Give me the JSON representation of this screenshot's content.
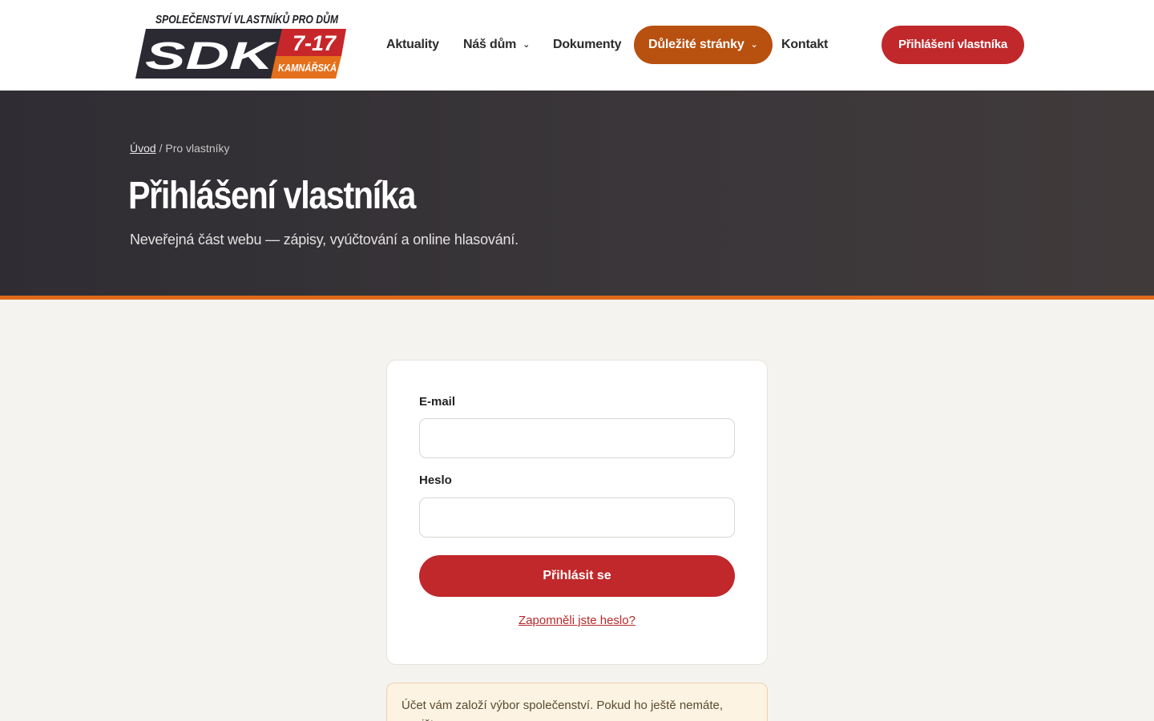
{
  "header": {
    "logo": {
      "top_line": "SPOLEČENSTVÍ VLASTNÍKŮ PRO DŮM",
      "abbr": "SDK",
      "number": "7-17",
      "street": "KAMNÁŘSKÁ"
    },
    "nav": [
      {
        "label": "Aktuality",
        "dropdown": false,
        "active": false
      },
      {
        "label": "Náš dům",
        "dropdown": true,
        "active": false
      },
      {
        "label": "Dokumenty",
        "dropdown": false,
        "active": false
      },
      {
        "label": "Důležité stránky",
        "dropdown": true,
        "active": true
      },
      {
        "label": "Kontakt",
        "dropdown": false,
        "active": false
      }
    ],
    "cta_label": "Přihlášení vlastníka"
  },
  "hero": {
    "breadcrumb": {
      "home": "Úvod",
      "separator": "/",
      "current": "Pro vlastníky"
    },
    "title": "Přihlášení vlastníka",
    "subtitle": "Neveřejná část webu — zápisy, vyúčtování a online hlasování."
  },
  "login": {
    "email_label": "E-mail",
    "email_value": "",
    "password_label": "Heslo",
    "password_value": "",
    "submit_label": "Přihlásit se",
    "forgot_label": "Zapomněli jste heslo?"
  },
  "notice": {
    "text": "Účet vám založí výbor společenství. Pokud ho ještě nemáte, napište"
  },
  "colors": {
    "accent_red": "#c0282b",
    "accent_orange": "#b8500f",
    "hero_bar": "#e06a1a",
    "hero_bg": "#37333a",
    "page_bg": "#f5f3ef"
  },
  "icons": {
    "dropdown": "chevron-down-icon"
  }
}
